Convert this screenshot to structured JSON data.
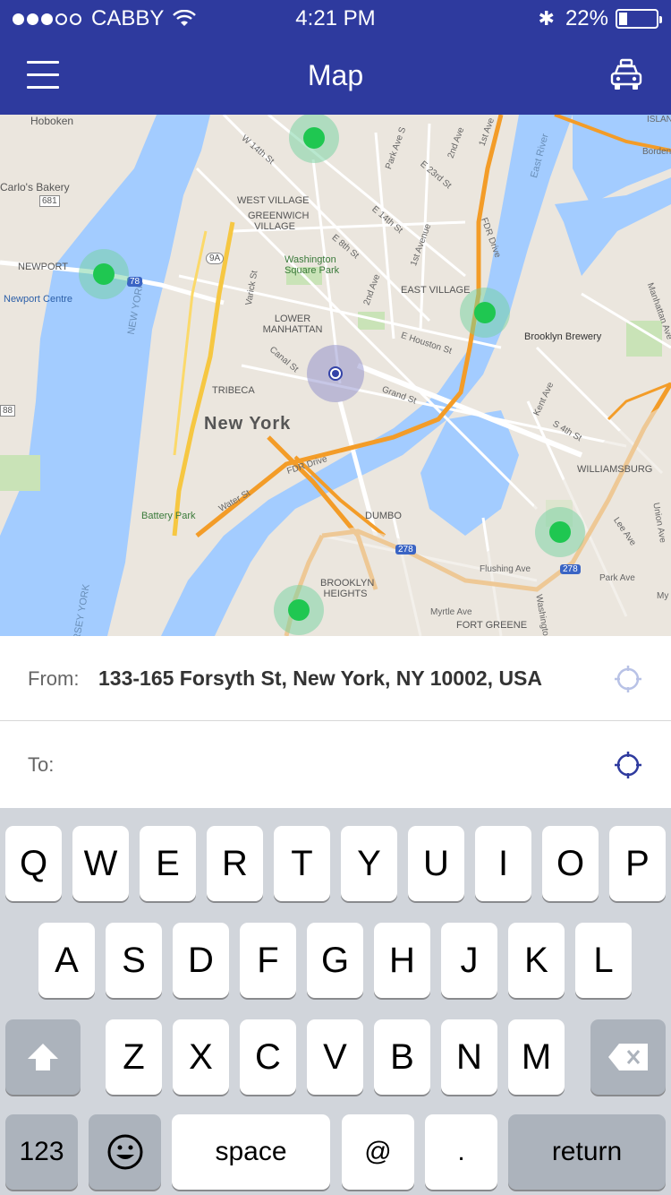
{
  "status_bar": {
    "carrier": "CABBY",
    "time": "4:21 PM",
    "battery": "22%",
    "battery_level": 0.22
  },
  "header": {
    "title": "Map",
    "menu_icon": "hamburger-menu-icon",
    "right_icon": "taxi-icon",
    "color": "#2e3a9e"
  },
  "map": {
    "labels": {
      "hoboken": "Hoboken",
      "carlos": "Carlo's Bakery",
      "r681": "681",
      "newport": "NEWPORT",
      "newport_centre": "Newport Centre",
      "west_village": "WEST VILLAGE",
      "greenwich": "GREENWICH VILLAGE",
      "washington": "Washington Square Park",
      "east_village": "EAST VILLAGE",
      "lower_manhattan": "LOWER MANHATTAN",
      "tribeca": "TRIBECA",
      "new_york": "New York",
      "battery_park": "Battery Park",
      "dumbo": "DUMBO",
      "brooklyn_heights": "BROOKLYN HEIGHTS",
      "williamsburg": "WILLIAMSBURG",
      "brooklyn_brewery": "Brooklyn Brewery",
      "fort_greene": "FORT GREENE",
      "flushing": "Flushing Ave",
      "park_ave": "Park Ave",
      "myrtle": "Myrtle Ave",
      "fdr_drive": "FDR Drive",
      "fdr_drive2": "FDR Drive",
      "houston": "E Houston St",
      "canal": "Canal St",
      "grand": "Grand St",
      "s4th": "S 4th St",
      "kent": "Kent Ave",
      "lee": "Lee Ave",
      "water": "Water St",
      "varick": "Varick St",
      "second_ave": "2nd Ave",
      "first_ave": "1st Avenue",
      "e14": "E 14th St",
      "w14": "W 14th St",
      "e8": "E 8th St",
      "e23": "E 23rd St",
      "east_river_label": "East River",
      "manhattan_ave": "Manhattan Ave",
      "union_ave": "Union Ave",
      "new_york_water": "NEW YORK",
      "jersey": "JERSEY YORK",
      "borden": "Borden",
      "island": "ISLAN",
      "washington_ave": "Washington",
      "park_ave_s": "Park Ave S",
      "second_ave_top": "2nd Ave",
      "first_ave_top": "1st Ave",
      "r78": "78",
      "r278": "278",
      "r278b": "278",
      "r9a": "9A",
      "r88": "88",
      "my": "My"
    },
    "marker_color": "#1fc751"
  },
  "route": {
    "from_label": "From:",
    "from_value": "133-165 Forsyth St, New York, NY 10002, USA",
    "to_label": "To:",
    "to_value": "",
    "from_icon": "crosshair-location-icon",
    "to_icon": "crosshair-location-icon"
  },
  "keyboard": {
    "row1": [
      "Q",
      "W",
      "E",
      "R",
      "T",
      "Y",
      "U",
      "I",
      "O",
      "P"
    ],
    "row2": [
      "A",
      "S",
      "D",
      "F",
      "G",
      "H",
      "J",
      "K",
      "L"
    ],
    "row3": [
      "Z",
      "X",
      "C",
      "V",
      "B",
      "N",
      "M"
    ],
    "shift_icon": "shift-arrow-icon",
    "delete_icon": "backspace-icon",
    "numbers": "123",
    "emoji_icon": "emoji-face-icon",
    "space": "space",
    "at": "@",
    "dot": ".",
    "return": "return"
  }
}
